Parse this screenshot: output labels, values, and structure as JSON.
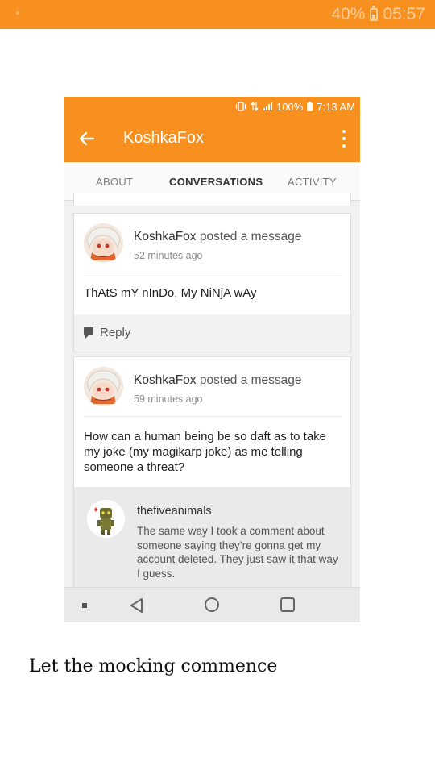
{
  "outer_status": {
    "battery": "40%",
    "time": "05:57"
  },
  "inner_status": {
    "battery": "100%",
    "time": "7:13 AM"
  },
  "appbar": {
    "title": "KoshkaFox"
  },
  "tabs": [
    {
      "label": "ABOUT",
      "active": false
    },
    {
      "label": "CONVERSATIONS",
      "active": true
    },
    {
      "label": "ACTIVITY",
      "active": false
    }
  ],
  "posts": [
    {
      "author": "KoshkaFox",
      "action": "posted a message",
      "time": "52 minutes ago",
      "message": "ThAtS mY nInDo, My NiNjA wAy",
      "reply_label": "Reply"
    },
    {
      "author": "KoshkaFox",
      "action": "posted a message",
      "time": "59 minutes ago",
      "message": "How can a human being be so daft as to take my joke (my magikarp joke) as me telling someone a threat?",
      "comment": {
        "author": "thefiveanimals",
        "text": "The same way I took a comment about someone saying they’re gonna get my account deleted. They just saw it that way I guess."
      }
    }
  ],
  "caption": "Let the mocking commence",
  "colors": {
    "accent": "#f7901e",
    "tab_indicator": "#11a9b9"
  }
}
